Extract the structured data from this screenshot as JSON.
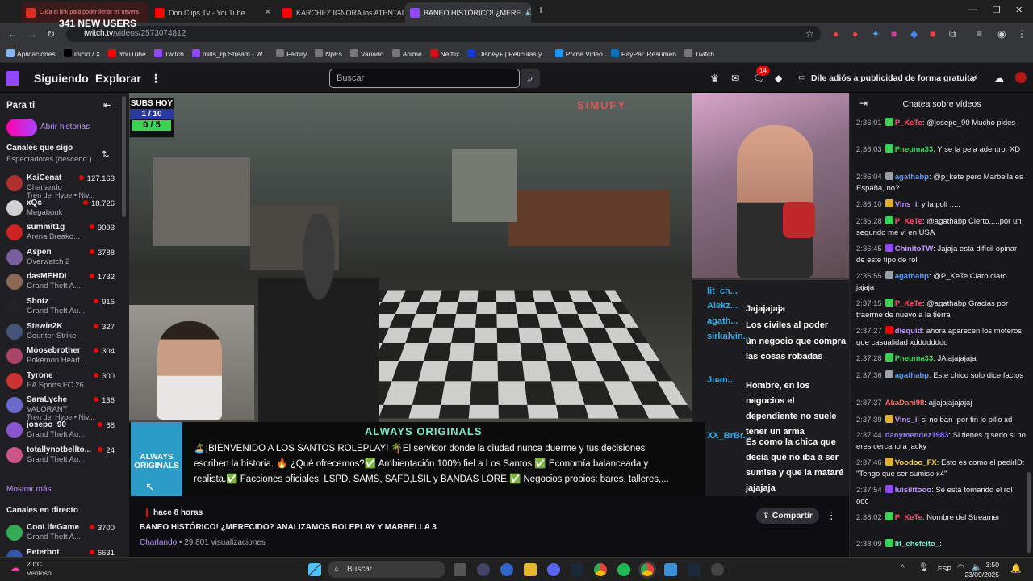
{
  "browser": {
    "tabs": [
      {
        "label": "Clica el link para poder llenar mi nevera",
        "color": "#d93025"
      },
      {
        "label": "Don Clips Tv - YouTube",
        "color": "#ff0000"
      },
      {
        "label": "KARCHEZ IGNORA los ATENTAD",
        "color": "#ff0000"
      },
      {
        "label": "BANEO HISTÓRICO! ¿MERE",
        "color": "#9147ff",
        "active": true
      }
    ],
    "url_host": "twitch.tv",
    "url_path": "/videos/2573074812",
    "bookmarks": [
      {
        "label": "Aplicaciones",
        "color": "#8ab4f8"
      },
      {
        "label": "Inicio / X",
        "color": "#000000"
      },
      {
        "label": "YouTube",
        "color": "#ff0000"
      },
      {
        "label": "Twitch",
        "color": "#9147ff"
      },
      {
        "label": "mills_rp Stream - W...",
        "color": "#9147ff"
      },
      {
        "label": "Family",
        "color": "#777777"
      },
      {
        "label": "NpEs",
        "color": "#777777"
      },
      {
        "label": "Variado",
        "color": "#777777"
      },
      {
        "label": "Anime",
        "color": "#777777"
      },
      {
        "label": "Netflix",
        "color": "#e50914"
      },
      {
        "label": "Disney+ | Películas y...",
        "color": "#113ccf"
      },
      {
        "label": "Prime Video",
        "color": "#1a98ff"
      },
      {
        "label": "PayPal: Resumen",
        "color": "#0070ba"
      },
      {
        "label": "Twitch",
        "color": "#777777"
      }
    ]
  },
  "twitch_nav": {
    "following": "Siguiendo",
    "browse": "Explorar",
    "search_placeholder": "Buscar",
    "notifications_count": "14",
    "adfree": "Dile adiós a publicidad de forma gratuita"
  },
  "sidebar": {
    "for_you": "Para ti",
    "open_stories": "Abrir historias",
    "followed_header": "Canales que sigo",
    "sort_label": "Espectadores (descend.)",
    "channels": [
      {
        "name": "KaiCenat",
        "game": "Charlando",
        "viewers": "127.163",
        "tag": "Tren del Hype • Niv...",
        "color": "#b03030"
      },
      {
        "name": "xQc",
        "game": "Megabonk",
        "viewers": "18.726",
        "color": "#d0d0d0"
      },
      {
        "name": "summit1g",
        "game": "Arena Breako...",
        "viewers": "9093",
        "color": "#cc2222"
      },
      {
        "name": "Aspen",
        "game": "Overwatch 2",
        "viewers": "3788",
        "color": "#7a5fa0"
      },
      {
        "name": "dasMEHDI",
        "game": "Grand Theft A...",
        "viewers": "1732",
        "color": "#8b6a55"
      },
      {
        "name": "Shotz",
        "game": "Grand Theft Au...",
        "viewers": "916",
        "color": "#222222"
      },
      {
        "name": "Stewie2K",
        "game": "Counter-Strike",
        "viewers": "327",
        "color": "#445577"
      },
      {
        "name": "Moosebrother",
        "game": "Pokémon Heart...",
        "viewers": "304",
        "color": "#aa4466"
      },
      {
        "name": "Tyrone",
        "game": "EA Sports FC 26",
        "viewers": "300",
        "color": "#cc3333"
      },
      {
        "name": "SaraLyche",
        "game": "VALORANT",
        "viewers": "136",
        "tag": "Tren del Hype • Niv...",
        "color": "#6a6acc"
      },
      {
        "name": "josepo_90",
        "game": "Grand Theft Au...",
        "viewers": "68",
        "color": "#8855cc"
      },
      {
        "name": "totallynotbellto...",
        "game": "Grand Theft Au...",
        "viewers": "24",
        "color": "#cc5588"
      }
    ],
    "show_more": "Mostrar más",
    "live_header": "Canales en directo",
    "live_channels": [
      {
        "name": "CooLifeGame",
        "game": "Grand Theft A...",
        "viewers": "3700",
        "color": "#33aa55"
      },
      {
        "name": "Peterbot",
        "game": "",
        "viewers": "6631",
        "color": "#3355aa"
      }
    ]
  },
  "video": {
    "subs_label": "SUBS HOY",
    "subs_progress": "1 / 10",
    "subs_count": "0 / 5",
    "new_users": "341 NEW USERS",
    "brand": "SIMUFY",
    "overlay_chat": [
      {
        "user": "lit_ch...",
        "text": ""
      },
      {
        "user": "Alekz...",
        "text": "Jajajajaja"
      },
      {
        "user": "agath...",
        "text": "Los civiles al poder"
      },
      {
        "user": "sirkalvin...",
        "text": "un negocio que compra las cosas robadas"
      },
      {
        "user": "Juan...",
        "text": "Hombre, en los negocios el dependiente no suele tener un arma"
      },
      {
        "user": "XX_BrBr...",
        "text": "Es como la chica que decía que no iba a ser sumisa y que la mataré jajajaja"
      }
    ],
    "banner_logo": "ALWAYS ORIGINALS",
    "banner_title": "ALWAYS ORIGINALS",
    "banner_text": "🏝️¡BIENVENIDO A LOS SANTOS ROLEPLAY! 🌴El servidor donde la ciudad nunca duerme y tus decisiones escriben la historia. 🔥 ¿Qué ofrecemos?✅ Ambientación 100% fiel a Los Santos.✅ Economía balanceada y realista.✅ Facciones oficiales: LSPD, SAMS, SAFD,LSIL y BANDAS LORE.✅ Negocios propios: bares, talleres,..."
  },
  "video_info": {
    "ago": "hace 8 horas",
    "title": "BANEO HISTÓRICO! ¿MERECIDO? ANALIZAMOS ROLEPLAY Y MARBELLA 3",
    "category": "Charlando",
    "views": " • 29.801 visualizaciones",
    "share": "Compartir"
  },
  "chat": {
    "header": "Chatea sobre vídeos",
    "messages": [
      {
        "time": "2:36:01",
        "user": "P_KeTe",
        "color": "#ff4d6d",
        "text": "@josepo_90 Mucho pides",
        "badge": "#39d353"
      },
      {
        "time": "2:36:03",
        "user": "Pneuma33",
        "color": "#39d353",
        "text": "Y se la pela adentro. XD",
        "badge": "#39d353"
      },
      {
        "time": "2:36:04",
        "user": "agathabp",
        "color": "#5b9bff",
        "text": "@p_kete pero Marbella es España, no?",
        "badge": "#9aa0a6"
      },
      {
        "time": "2:36:10",
        "user": "Vins_i",
        "color": "#bf94ff",
        "text": "y la poli .....",
        "badge": "#e0b030"
      },
      {
        "time": "2:36:28",
        "user": "P_KeTe",
        "color": "#ff4d6d",
        "text": "@agathabp Cierto.....por un segundo me vi en USA",
        "badge": "#39d353"
      },
      {
        "time": "2:36:45",
        "user": "ChinitoTW",
        "color": "#bf94ff",
        "text": "Jajaja está difícil opinar de este tipo de rol",
        "badge": "#9147ff"
      },
      {
        "time": "2:36:55",
        "user": "agathabp",
        "color": "#5b9bff",
        "text": "@P_KeTe Claro claro jajaja",
        "badge": "#9aa0a6"
      },
      {
        "time": "2:37:15",
        "user": "P_KeTe",
        "color": "#ff4d6d",
        "text": "@agathabp Gracias por traerme de nuevo a la tierra",
        "badge": "#39d353"
      },
      {
        "time": "2:37:27",
        "user": "diequid",
        "color": "#bf94ff",
        "text": "ahora aparecen los moteros que casualidad xdddddddd",
        "badge": "#eb0400"
      },
      {
        "time": "2:37:28",
        "user": "Pneuma33",
        "color": "#39d353",
        "text": "JAjajajajaja",
        "badge": "#39d353"
      },
      {
        "time": "2:37:36",
        "user": "agathabp",
        "color": "#5b9bff",
        "text": "Este chico solo dice factos",
        "badge": "#9aa0a6"
      },
      {
        "time": "2:37:37",
        "user": "AkaDani98",
        "color": "#ff6b6b",
        "text": "ajjajajajajajaj",
        "badge": ""
      },
      {
        "time": "2:37:39",
        "user": "Vins_i",
        "color": "#bf94ff",
        "text": "si no ban ,por fin lo pillo xd",
        "badge": "#e0b030"
      },
      {
        "time": "2:37:44",
        "user": "danymendez1983",
        "color": "#8f7dff",
        "text": "Si tienes q serlo si no eres cercano a jacky",
        "badge": ""
      },
      {
        "time": "2:37:46",
        "user": "Voodoo_FX",
        "color": "#ffd24d",
        "text": "Esto es como el pedirID: \"Tengo que ser sumiso x4\"",
        "badge": "#e0b030"
      },
      {
        "time": "2:37:54",
        "user": "luisiittooo",
        "color": "#bf94ff",
        "text": "Se está tomando el rol ooc",
        "badge": "#9147ff"
      },
      {
        "time": "2:38:02",
        "user": "P_KeTe",
        "color": "#ff4d6d",
        "text": "Nombre del Streamer",
        "badge": "#39d353"
      },
      {
        "time": "2:38:09",
        "user": "lit_chefcito_",
        "color": "#7de6c8",
        "text": "",
        "badge": "#39d353"
      }
    ]
  },
  "taskbar": {
    "weather_temp": "20°C",
    "weather_desc": "Ventoso",
    "search": "Buscar",
    "lang": "ESP",
    "time": "3:50",
    "date": "23/09/2025"
  }
}
